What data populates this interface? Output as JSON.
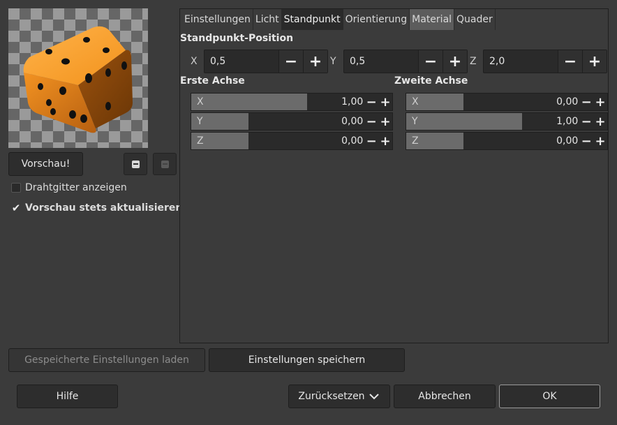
{
  "preview": {
    "button_label": "Vorschau!",
    "zoom_out_icon": "zoom-out-icon",
    "zoom_in_icon": "zoom-in-icon"
  },
  "options": {
    "wireframe_label": "Drahtgitter anzeigen",
    "wireframe_checked": false,
    "auto_update_label": "Vorschau stets aktualisieren",
    "auto_update_checked": true
  },
  "tabs": [
    {
      "label": "Einstellungen"
    },
    {
      "label": "Licht"
    },
    {
      "label": "Standpunkt"
    },
    {
      "label": "Orientierung"
    },
    {
      "label": "Material"
    },
    {
      "label": "Quader"
    }
  ],
  "active_tab": "Standpunkt",
  "viewpoint": {
    "title": "Standpunkt-Position",
    "x_label": "X",
    "x_value": "0,5",
    "y_label": "Y",
    "y_value": "0,5",
    "z_label": "Z",
    "z_value": "2,0",
    "minus": "−",
    "plus": "+"
  },
  "first_axis": {
    "title": "Erste Achse",
    "rows": [
      {
        "label": "X",
        "value": "1,00",
        "fill": 0.67
      },
      {
        "label": "Y",
        "value": "0,00",
        "fill": 0.33
      },
      {
        "label": "Z",
        "value": "0,00",
        "fill": 0.33
      }
    ]
  },
  "second_axis": {
    "title": "Zweite Achse",
    "rows": [
      {
        "label": "X",
        "value": "0,00",
        "fill": 0.33
      },
      {
        "label": "Y",
        "value": "1,00",
        "fill": 0.67
      },
      {
        "label": "Z",
        "value": "0,00",
        "fill": 0.33
      }
    ]
  },
  "footer": {
    "load_label": "Gespeicherte Einstellungen laden",
    "save_label": "Einstellungen speichern",
    "help_label": "Hilfe",
    "reset_label": "Zurücksetzen",
    "cancel_label": "Abbrechen",
    "ok_label": "OK"
  },
  "colors": {
    "background": "#3b3b3b",
    "dice": "#f0901a"
  }
}
